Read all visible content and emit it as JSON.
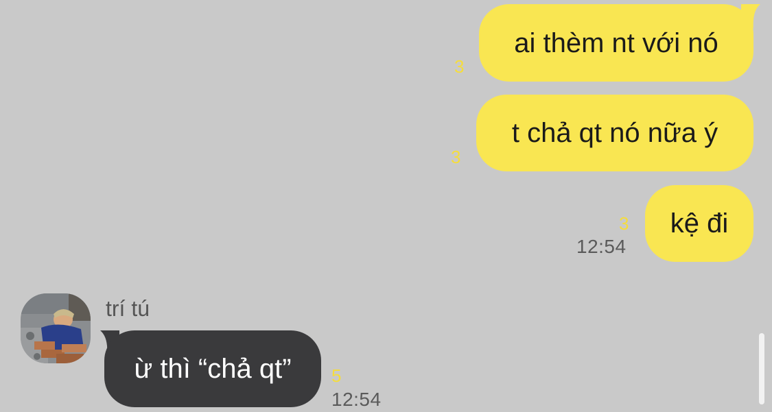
{
  "chat": {
    "messages": [
      {
        "side": "sent",
        "text": "ai thèm nt với nó",
        "unread_count": "3"
      },
      {
        "side": "sent",
        "text": "t chả qt nó nữa ý",
        "unread_count": "3"
      },
      {
        "side": "sent",
        "text": "kệ đi",
        "unread_count": "3",
        "time": "12:54"
      },
      {
        "side": "received",
        "sender": "trí tú",
        "text": "ừ thì “chả qt”",
        "unread_count": "5",
        "time": "12:54"
      }
    ]
  },
  "colors": {
    "background": "#c9c9c9",
    "sent_bubble": "#f9e652",
    "received_bubble": "#3a3a3c",
    "unread_count": "#f5dd3c",
    "timestamp": "#5a5a5a"
  }
}
